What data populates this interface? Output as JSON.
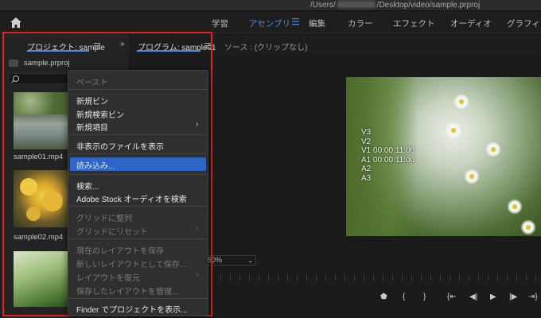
{
  "titlebar": {
    "path_prefix": "/Users/",
    "path_suffix": "/Desktop/video/sample.prproj"
  },
  "workspaces": [
    {
      "label": "学習",
      "active": false
    },
    {
      "label": "アセンブリ",
      "active": true
    },
    {
      "label": "編集",
      "active": false
    },
    {
      "label": "カラー",
      "active": false
    },
    {
      "label": "エフェクト",
      "active": false
    },
    {
      "label": "オーディオ",
      "active": false
    },
    {
      "label": "グラフィッ",
      "active": false
    }
  ],
  "panels": {
    "project_tab": "プロジェクト: sample",
    "program_tab": "プログラム: sample01",
    "source_tab": "ソース : (クリップなし)",
    "project_file": "sample.prproj"
  },
  "clips": [
    {
      "name": "sample01.mp4"
    },
    {
      "name": "sample02.mp4"
    },
    {
      "name": ""
    }
  ],
  "overlay_lines": [
    "V3",
    "V2",
    "V1 00:00:11:00",
    "A1 00:00:11:00",
    "A2",
    "A3"
  ],
  "zoom": "50%",
  "context_menu": {
    "paste": "ペースト",
    "new_bin": "新規ビン",
    "new_search_bin": "新規検索ビン",
    "new_item": "新規項目",
    "show_hidden": "非表示のファイルを表示",
    "import": "読み込み...",
    "find": "検索...",
    "adobe_stock": "Adobe Stock オーディオを検索",
    "align_grid": "グリッドに整列",
    "reset_grid": "グリッドにリセット",
    "save_layout": "現在のレイアウトを保存",
    "save_new_layout": "新しいレイアウトとして保存...",
    "restore_layout": "レイアウトを復元",
    "manage_layouts": "保存したレイアウトを管理...",
    "reveal_finder": "Finder でプロジェクトを表示..."
  },
  "colors": {
    "accent": "#4b8be8",
    "highlight": "#2d65c8",
    "annotation": "#e02222"
  }
}
